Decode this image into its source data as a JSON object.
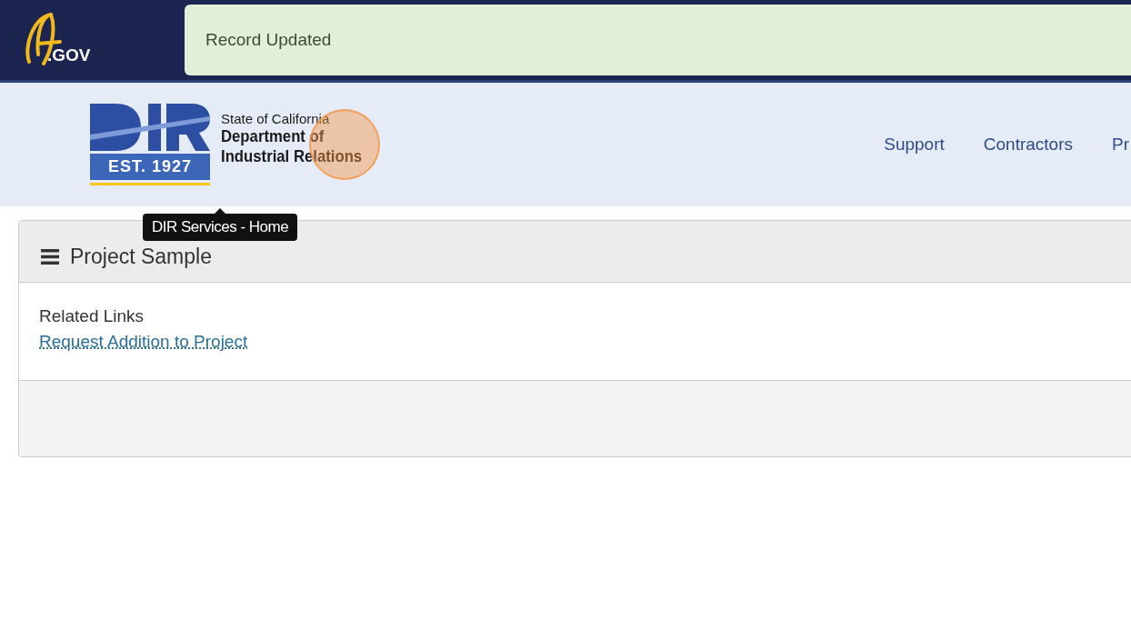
{
  "top_bar": {
    "logo_text": ".GOV",
    "alert": {
      "kind": "success",
      "message": "Record Updated"
    }
  },
  "header": {
    "logo": {
      "badge": "EST. 1927",
      "line_1": "State of California",
      "line_2": "Department of",
      "line_3": "Industrial Relations"
    },
    "tooltip": "DIR Services - Home",
    "nav": [
      {
        "label": "Support"
      },
      {
        "label": "Contractors"
      },
      {
        "label": "Pr"
      }
    ]
  },
  "card": {
    "title": "Project Sample",
    "section_label": "Related Links",
    "links": [
      "Request Addition to Project"
    ]
  }
}
